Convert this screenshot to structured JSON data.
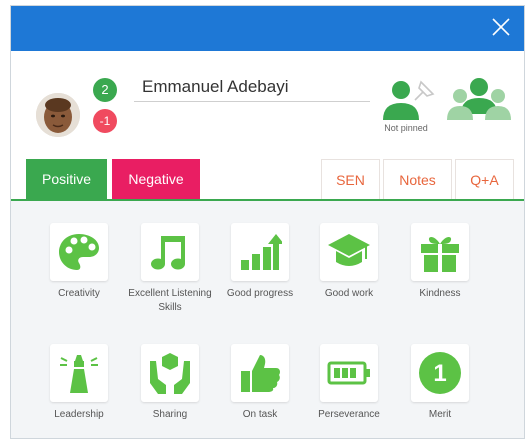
{
  "student": {
    "name": "Emmanuel Adebayi",
    "positive_points": "2",
    "negative_points": "-1",
    "pin_status": "Not pinned"
  },
  "tabs": {
    "positive": "Positive",
    "negative": "Negative",
    "sen": "SEN",
    "notes": "Notes",
    "qa": "Q+A"
  },
  "behaviours": [
    {
      "label": "Creativity",
      "icon": "palette-icon"
    },
    {
      "label": "Excellent Listening Skills",
      "icon": "music-note-icon"
    },
    {
      "label": "Good progress",
      "icon": "rising-bars-icon"
    },
    {
      "label": "Good work",
      "icon": "graduation-cap-icon"
    },
    {
      "label": "Kindness",
      "icon": "gift-icon"
    },
    {
      "label": "Leadership",
      "icon": "lighthouse-icon"
    },
    {
      "label": "Sharing",
      "icon": "hands-cube-icon"
    },
    {
      "label": "On task",
      "icon": "thumbs-up-icon"
    },
    {
      "label": "Perseverance",
      "icon": "battery-icon"
    },
    {
      "label": "Merit",
      "icon": "merit-one-icon",
      "value": "1"
    }
  ],
  "colors": {
    "header_blue": "#1e78d6",
    "positive_green": "#3aa84f",
    "negative_pink": "#e91e63",
    "icon_green": "#5cc245",
    "side_tab_text": "#e8663d",
    "negative_badge": "#f04a5f"
  }
}
